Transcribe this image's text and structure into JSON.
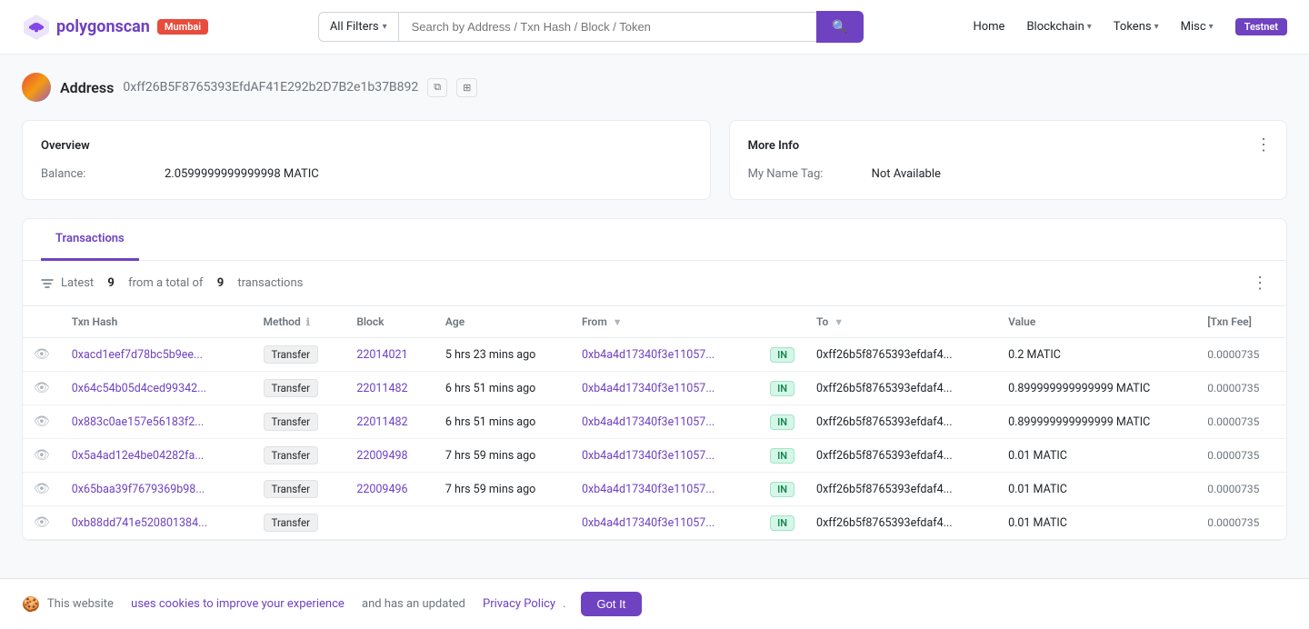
{
  "header": {
    "logo_text": "polygonscan",
    "network_badge": "Mumbai",
    "search_placeholder": "Search by Address / Txn Hash / Block / Token",
    "filter_label": "All Filters",
    "nav": {
      "home": "Home",
      "blockchain": "Blockchain",
      "tokens": "Tokens",
      "misc": "Misc",
      "testnet": "Testnet"
    }
  },
  "address": {
    "label": "Address",
    "hash": "0xff26B5F8765393EfdAF41E292b2D7B2e1b37B892",
    "copy_title": "Copy",
    "qr_title": "QR"
  },
  "overview": {
    "title": "Overview",
    "balance_label": "Balance:",
    "balance_value": "2.0599999999999998 MATIC"
  },
  "more_info": {
    "title": "More Info",
    "name_tag_label": "My Name Tag:",
    "name_tag_value": "Not Available"
  },
  "transactions": {
    "tab_label": "Transactions",
    "info_text": "Latest",
    "count": "9",
    "total_label": "from a total of",
    "total_count": "9",
    "total_suffix": "transactions",
    "columns": {
      "txn_hash": "Txn Hash",
      "method": "Method",
      "block": "Block",
      "age": "Age",
      "from": "From",
      "to": "To",
      "value": "Value",
      "txn_fee": "[Txn Fee]"
    },
    "rows": [
      {
        "txn_hash": "0xacd1eef7d78bc5b9ee...",
        "method": "Transfer",
        "block": "22014021",
        "age": "5 hrs 23 mins ago",
        "from": "0xb4a4d17340f3e11057...",
        "direction": "IN",
        "to": "0xff26b5f8765393efdaf4...",
        "value": "0.2 MATIC",
        "fee": "0.0000735"
      },
      {
        "txn_hash": "0x64c54b05d4ced99342...",
        "method": "Transfer",
        "block": "22011482",
        "age": "6 hrs 51 mins ago",
        "from": "0xb4a4d17340f3e11057...",
        "direction": "IN",
        "to": "0xff26b5f8765393efdaf4...",
        "value": "0.899999999999999 MATIC",
        "fee": "0.0000735"
      },
      {
        "txn_hash": "0x883c0ae157e56183f2...",
        "method": "Transfer",
        "block": "22011482",
        "age": "6 hrs 51 mins ago",
        "from": "0xb4a4d17340f3e11057...",
        "direction": "IN",
        "to": "0xff26b5f8765393efdaf4...",
        "value": "0.899999999999999 MATIC",
        "fee": "0.0000735"
      },
      {
        "txn_hash": "0x5a4ad12e4be04282fa...",
        "method": "Transfer",
        "block": "22009498",
        "age": "7 hrs 59 mins ago",
        "from": "0xb4a4d17340f3e11057...",
        "direction": "IN",
        "to": "0xff26b5f8765393efdaf4...",
        "value": "0.01 MATIC",
        "fee": "0.0000735"
      },
      {
        "txn_hash": "0x65baa39f7679369b98...",
        "method": "Transfer",
        "block": "22009496",
        "age": "7 hrs 59 mins ago",
        "from": "0xb4a4d17340f3e11057...",
        "direction": "IN",
        "to": "0xff26b5f8765393efdaf4...",
        "value": "0.01 MATIC",
        "fee": "0.0000735"
      },
      {
        "txn_hash": "0xb88dd741e520801384...",
        "method": "Transfer",
        "block": "",
        "age": "",
        "from": "0xb4a4d17340f3e11057...",
        "direction": "IN",
        "to": "0xff26b5f8765393efdaf4...",
        "value": "0.01 MATIC",
        "fee": "0.0000735"
      }
    ]
  },
  "cookie": {
    "text_before": "This website",
    "link1_text": "uses cookies to improve your experience",
    "text_middle": "and has an updated",
    "link2_text": "Privacy Policy",
    "text_after": ".",
    "button_label": "Got It"
  },
  "colors": {
    "accent": "#6f42c1",
    "in_badge_bg": "#d4f7e8",
    "in_badge_text": "#198754"
  }
}
